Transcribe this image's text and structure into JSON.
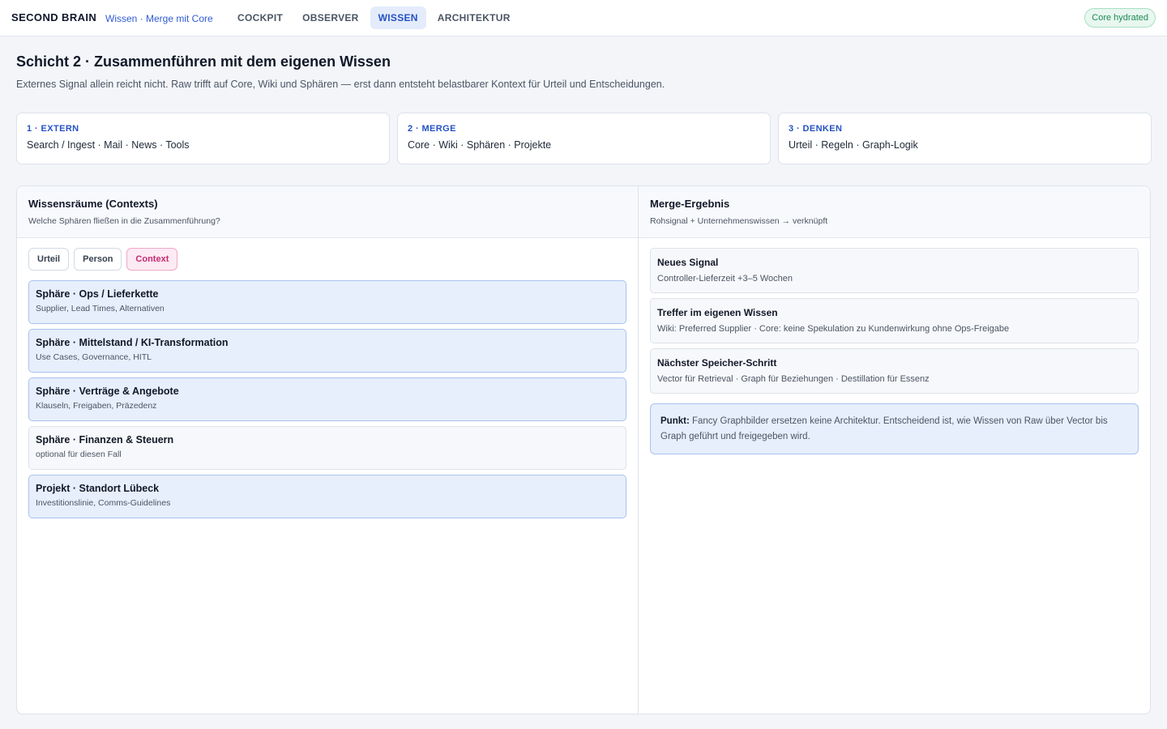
{
  "app": {
    "brand": "SECOND BRAIN",
    "breadcrumb": "Wissen · Merge mit Core",
    "status": "Core hydrated"
  },
  "nav": {
    "items": [
      {
        "label": "COCKPIT",
        "active": false
      },
      {
        "label": "OBSERVER",
        "active": false
      },
      {
        "label": "WISSEN",
        "active": true
      },
      {
        "label": "ARCHITEKTUR",
        "active": false
      }
    ]
  },
  "header": {
    "title": "Schicht 2 · Zusammenführen mit dem eigenen Wissen",
    "description": "Externes Signal allein reicht nicht. Raw trifft auf Core, Wiki und Sphären — erst dann entsteht belastbarer Kontext für Urteil und Entscheidungen."
  },
  "steps": [
    {
      "label": "1 · EXTERN",
      "text": "Search / Ingest · Mail · News · Tools"
    },
    {
      "label": "2 · MERGE",
      "text": "Core · Wiki · Sphären · Projekte"
    },
    {
      "label": "3 · DENKEN",
      "text": "Urteil · Regeln · Graph-Logik"
    }
  ],
  "contexts": {
    "title": "Wissensräume (Contexts)",
    "subtitle": "Welche Sphären fließen in die Zusammenführung?",
    "filters": [
      {
        "label": "Urteil",
        "active": false
      },
      {
        "label": "Person",
        "active": false
      },
      {
        "label": "Context",
        "active": true
      }
    ],
    "spheres": [
      {
        "title": "Sphäre · Ops / Lieferkette",
        "desc": "Supplier, Lead Times, Alternativen",
        "selected": true
      },
      {
        "title": "Sphäre · Mittelstand / KI-Transformation",
        "desc": "Use Cases, Governance, HITL",
        "selected": true
      },
      {
        "title": "Sphäre · Verträge & Angebote",
        "desc": "Klauseln, Freigaben, Präzedenz",
        "selected": true
      },
      {
        "title": "Sphäre · Finanzen & Steuern",
        "desc": "optional für diesen Fall",
        "selected": false
      },
      {
        "title": "Projekt · Standort Lübeck",
        "desc": "Investitionslinie, Comms-Guidelines",
        "selected": true
      }
    ]
  },
  "merge": {
    "title": "Merge-Ergebnis",
    "subtitle": "Rohsignal + Unternehmenswissen → verknüpft",
    "results": [
      {
        "title": "Neues Signal",
        "text": "Controller-Lieferzeit +3–5 Wochen"
      },
      {
        "title": "Treffer im eigenen Wissen",
        "text": "Wiki: Preferred Supplier · Core: keine Spekulation zu Kundenwirkung ohne Ops-Freigabe"
      },
      {
        "title": "Nächster Speicher-Schritt",
        "text": "Vector für Retrieval · Graph für Beziehungen · Destillation für Essenz"
      }
    ],
    "note": {
      "label": "Punkt:",
      "text": "Fancy Graphbilder ersetzen keine Architektur. Entscheidend ist, wie Wissen von Raw über Vector bis Graph geführt und freigegeben wird."
    }
  }
}
